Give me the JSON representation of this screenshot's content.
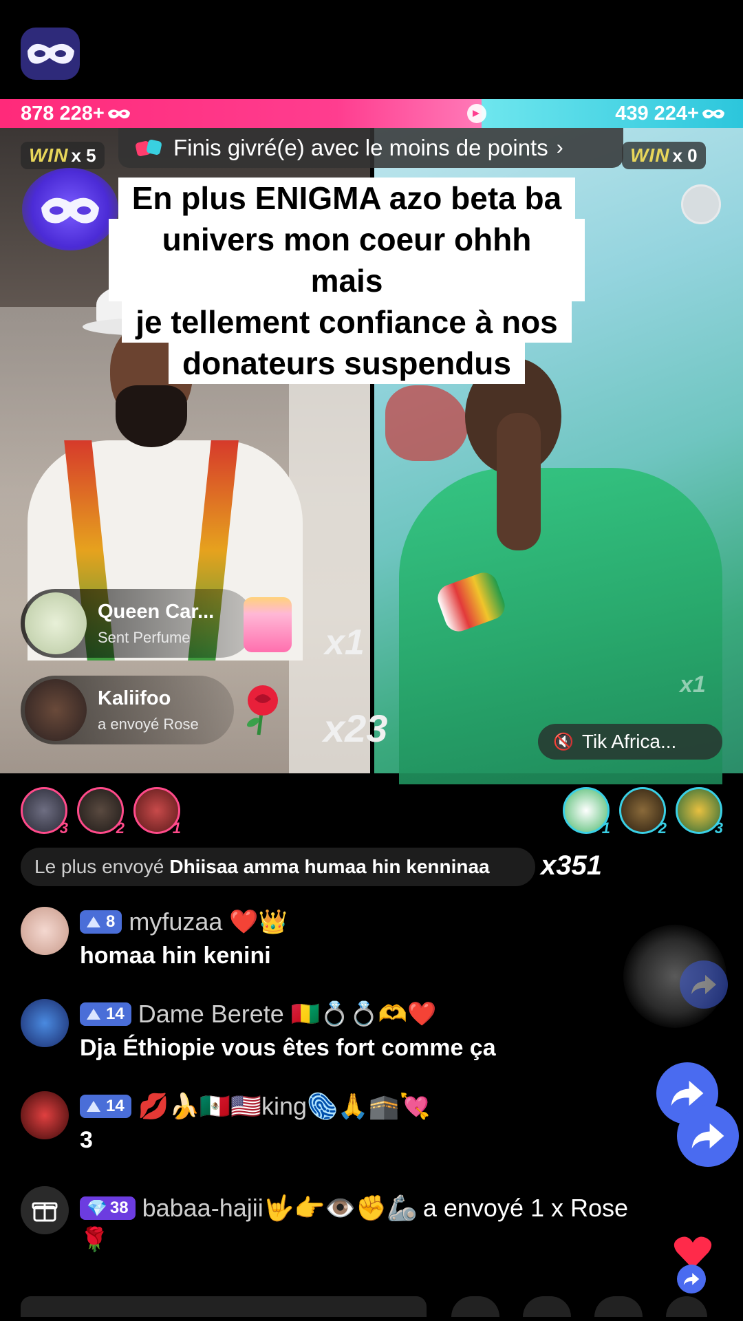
{
  "scores": {
    "left": "878 228+",
    "right": "439 224+",
    "color_left": "#ff3d8f",
    "color_right": "#2cc6dc"
  },
  "challenge": {
    "text": "Finis givré(e) avec le moins de points",
    "chevron": "›"
  },
  "win": {
    "left_label": "WIN",
    "left_count": "x 5",
    "right_label": "WIN",
    "right_count": "x 0"
  },
  "caption": {
    "lines": [
      "En plus ENIGMA azo beta ba",
      "univers mon coeur ohhh mais",
      "je tellement confiance à nos",
      "donateurs suspendus"
    ]
  },
  "gifts": [
    {
      "name": "Queen Car...",
      "action": "Sent Perfume",
      "multiplier": "x1",
      "icon": "perfume-icon"
    },
    {
      "name": "Kaliifoo",
      "action": "a envoyé  Rose",
      "multiplier": "x23",
      "icon": "rose-icon"
    }
  ],
  "right_ghost_multiplier": "x1",
  "opponent": {
    "name": "Tik Africa...",
    "muted_icon": "speaker-muted-icon"
  },
  "supporters": {
    "left": [
      {
        "rank": "3"
      },
      {
        "rank": "2"
      },
      {
        "rank": "1"
      }
    ],
    "right": [
      {
        "rank": "1"
      },
      {
        "rank": "2"
      },
      {
        "rank": "3"
      }
    ]
  },
  "top_gift": {
    "label": "Le plus envoyé",
    "value": "Dhiisaa amma humaa hin kenninaa",
    "count": "x351"
  },
  "chat": [
    {
      "level": "8",
      "user": "myfuzaa",
      "emojis": "❤️👑",
      "message": "homaa hin kenini"
    },
    {
      "level": "14",
      "user": "Dame Berete",
      "emojis": "🇬🇳💍💍🫶❤️",
      "message": "Dja Éthiopie vous êtes fort comme ça"
    },
    {
      "level": "14",
      "user": "💋🍌🇲🇽🇺🇸king🫆🙏🕋💘",
      "emojis": "",
      "message": "3"
    },
    {
      "level": "38",
      "user": "babaa-hajii🤟👉👁️✊🦾",
      "emojis": "",
      "message": "a envoyé 1 x Rose",
      "second_line": "🌹"
    }
  ]
}
